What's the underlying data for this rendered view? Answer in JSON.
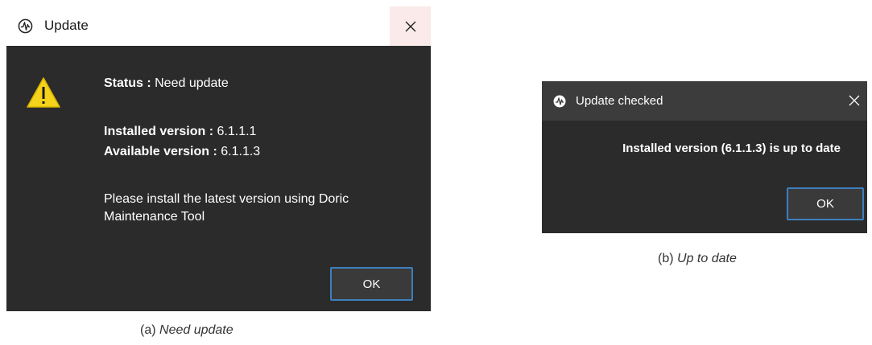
{
  "dialog_a": {
    "title": "Update",
    "icons": {
      "app": "doric-logo-icon",
      "close": "close-icon",
      "warning": "warning-icon"
    },
    "status_label": "Status :",
    "status_value": "Need update",
    "installed_label": "Installed version :",
    "installed_value": "6.1.1.1",
    "available_label": "Available version :",
    "available_value": "6.1.1.3",
    "message_line1": "Please install the latest version using Doric",
    "message_line2": "Maintenance Tool",
    "ok_label": "OK"
  },
  "dialog_b": {
    "title": "Update checked",
    "icons": {
      "app": "doric-logo-icon",
      "close": "close-icon"
    },
    "message": "Installed version (6.1.1.3) is up to date",
    "ok_label": "OK"
  },
  "captions": {
    "a_prefix": "(a)",
    "a_text": "Need update",
    "b_prefix": "(b)",
    "b_text": "Up to date"
  },
  "colors": {
    "dialog_bg": "#2b2b2b",
    "titlebar_dark": "#3c3c3c",
    "accent_border": "#3d7fbd",
    "warning_yellow": "#f5d31a",
    "close_hover": "#fbeaea"
  }
}
